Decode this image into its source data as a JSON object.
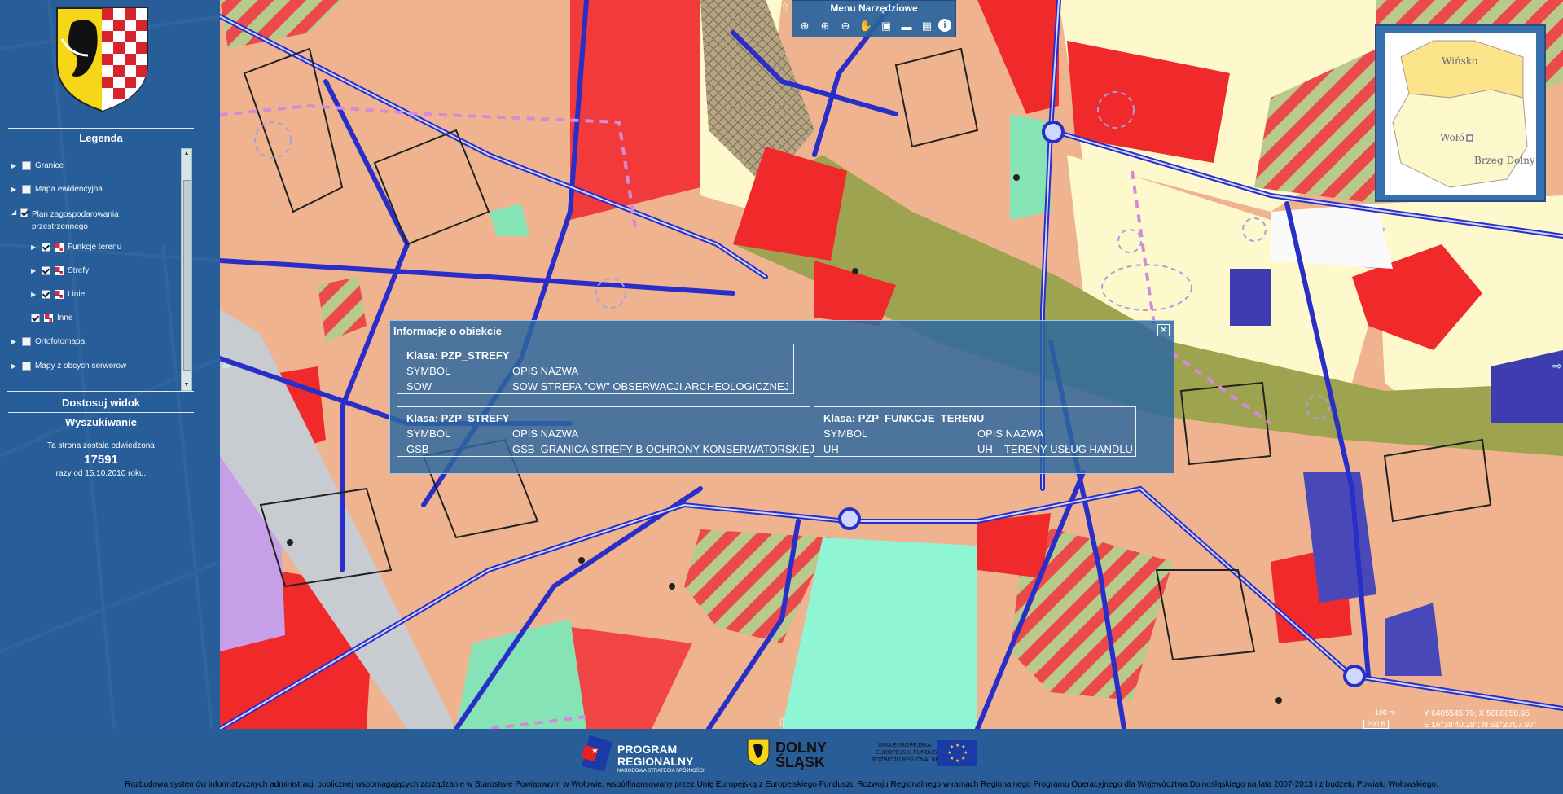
{
  "toolbar": {
    "title": "Menu Narzędziowe",
    "tools": [
      "zoom-extent-icon",
      "zoom-in-icon",
      "zoom-out-icon",
      "pan-hand-icon",
      "zoom-box-icon",
      "measure-distance-icon",
      "measure-area-icon",
      "info-icon"
    ]
  },
  "legend": {
    "title": "Legenda",
    "items": [
      {
        "label": "Granice",
        "checked": false
      },
      {
        "label": "Mapa ewidencyjna",
        "checked": false
      },
      {
        "label": "Plan zagospodarowania przestrzennego",
        "checked": true
      },
      {
        "label": "Funkcje terenu",
        "checked": true
      },
      {
        "label": "Strefy",
        "checked": true
      },
      {
        "label": "Linie",
        "checked": true
      },
      {
        "label": "Inne",
        "checked": true
      },
      {
        "label": "Ortofotomapa",
        "checked": false
      },
      {
        "label": "Mapy z obcych serwerow",
        "checked": false
      }
    ]
  },
  "sidebar": {
    "fit_view": "Dostosuj widok",
    "search": "Wyszukiwanie",
    "visit_line1": "Ta strona została odwiedzona",
    "visit_count": "17591",
    "visit_line3": "razy od 15.10.2010 roku."
  },
  "overview": {
    "labels": [
      "Wińsko",
      "Wołó",
      "Brzeg Dolny"
    ]
  },
  "info": {
    "title": "Informacje o obiekcie",
    "features": [
      {
        "class": "Klasa: PZP_STREFY",
        "h1": "SYMBOL",
        "h2": "OPIS NAZWA",
        "v1": "SOW",
        "v2": "SOW STREFA \"OW\" OBSERWACJI ARCHEOLOGICZNEJ"
      },
      {
        "class": "Klasa: PZP_STREFY",
        "h1": "SYMBOL",
        "h2": "OPIS NAZWA",
        "v1": "GSB",
        "v2": "GSB  GRANICA STREFY B OCHRONY KONSERWATORSKIEJ"
      },
      {
        "class": "Klasa: PZP_FUNKCJE_TERENU",
        "h1": "SYMBOL",
        "h2": "OPIS NAZWA",
        "v1": "UH",
        "v2": "UH    TERENY USŁUG HANDLU"
      }
    ]
  },
  "status": {
    "scale_a": "100 m",
    "scale_b": "200 ft",
    "coord_y": "Y 6405545.79; X 5688850.95",
    "coord_e": "E 16°38'40.28\"; N 51°20'07.97\""
  },
  "footer": {
    "logo1_line1": "PROGRAM",
    "logo1_line2": "REGIONALNY",
    "logo1_sub": "NARODOWA STRATEGIA SPÓJNOŚCI",
    "logo2_line1": "DOLNY",
    "logo2_line2": "ŚLĄSK",
    "logo3_line1": "UNIA EUROPEJSKA",
    "logo3_line2": "EUROPEJSKI FUNDUSZ",
    "logo3_line3": "ROZWOJU REGIONALNEGO",
    "credit": "Rozbudowa systemów informatycznych administracji publicznej wspomagających zarządzanie w Starostwie Powiatowym w Wołowie, współfinansowany przez Unię Europejską z Europejskiego Funduszu Rozwoju Regionalnego w ramach Regionalnego Programu Operacyjnego dla Województwa Dolnośląskiego na lata 2007-2013 i z budżetu Powiatu Wołowskiego."
  },
  "colors": {
    "commercial": "#f02a2a",
    "residential": "#efb48f",
    "green": "#9ea34f",
    "water": "#8ff5d5",
    "road": "#2a2ec8",
    "sidebar": "#2b5e96"
  }
}
